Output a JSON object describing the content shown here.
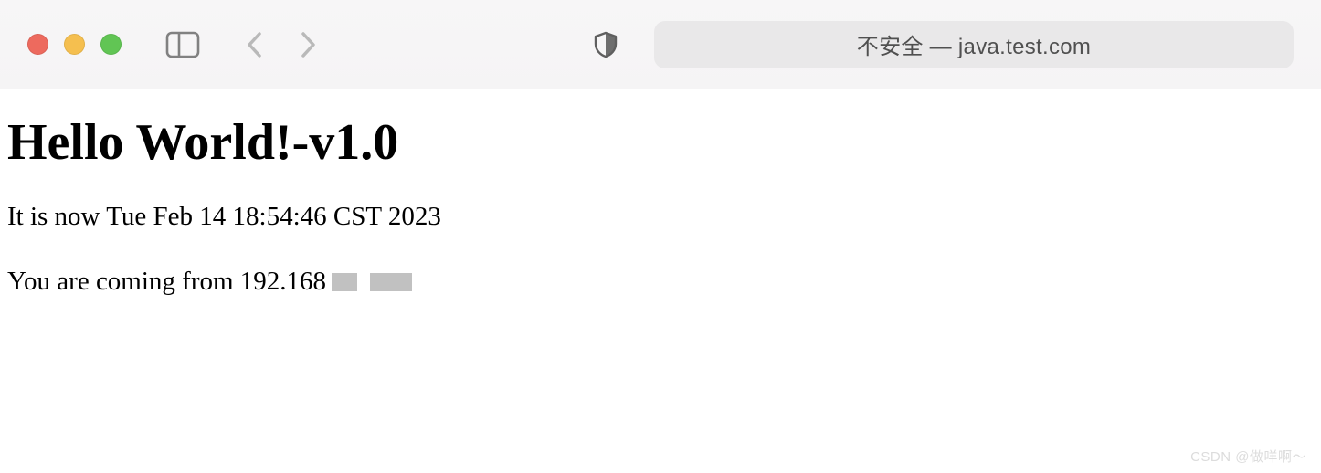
{
  "toolbar": {
    "address_text": "不安全 — java.test.com"
  },
  "page": {
    "heading": "Hello World!-v1.0",
    "time_line": "It is now Tue Feb 14 18:54:46 CST 2023",
    "ip_prefix": "You are coming from 192.168"
  },
  "watermark": "CSDN @做咩啊～"
}
